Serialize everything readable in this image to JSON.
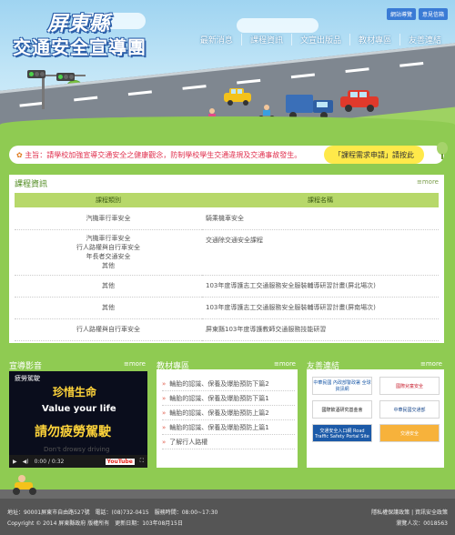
{
  "header": {
    "logo_line1": "屏東縣",
    "logo_line2": "交通安全宣導團",
    "top_links": [
      "網站導覽",
      "意見信箱"
    ],
    "nav": [
      "最新消息",
      "課程資訊",
      "文宣出版品",
      "教材專區",
      "友善連結"
    ]
  },
  "notice": {
    "label": "主旨：",
    "text": "請學校加強宣導交通安全之健康觀念，防制學校學生交通違規及交通事故發生。",
    "apply_label": "「課程需求申請」請按此"
  },
  "courses": {
    "title": "課程資訊",
    "more": "more",
    "columns": [
      "課程類別",
      "課程名稱"
    ],
    "rows": [
      {
        "category": "汽機車行車安全",
        "name": "騎乘機車安全"
      },
      {
        "category": "汽機車行車安全\n行人路權與自行車安全\n年長者交通安全\n其他",
        "name": "交通除交通安全課程"
      },
      {
        "category": "其他",
        "name": "103年度導護志工交通服務安全服裝輔導研習計畫(屏北場次)"
      },
      {
        "category": "其他",
        "name": "103年度導護志工交通服務安全服裝輔導研習計畫(屏南場次)"
      },
      {
        "category": "行人路權與自行車安全",
        "name": "屏東縣103年度導護教師交通服務技能研習"
      }
    ]
  },
  "video": {
    "title": "宣導影音",
    "more": "more",
    "player_title": "疲勞駕駛",
    "line1": "珍惜生命",
    "line2": "Value your life",
    "line3": "請勿疲勞駕駛",
    "line4": "Don't drowsy driving",
    "time": "0:00 / 0:32",
    "yt": "YouTube"
  },
  "materials": {
    "title": "教材專區",
    "more": "more",
    "items": [
      "輪胎的認識、保養及爆胎預防下篇2",
      "輪胎的認識、保養及爆胎預防下篇1",
      "輪胎的認識、保養及爆胎預防上篇2",
      "輪胎的認識、保養及爆胎預防上篇1",
      "了解行人路權"
    ]
  },
  "links": {
    "title": "友善連結",
    "more": "more",
    "logos": [
      {
        "text": "中華民國 內政部警政署 全球資訊網",
        "color": "#1c5aa8"
      },
      {
        "text": "國際兒童安全",
        "color": "#c8202f"
      },
      {
        "text": "國際飲酒研究基金會",
        "color": "#222222"
      },
      {
        "text": "中華民國交通部",
        "color": "#1c4b8f"
      },
      {
        "text": "交通安全入口網 Road Traffic Safety Portal Site",
        "color": "#1c5aa8"
      },
      {
        "text": "交通安全",
        "color": "#e07a1c"
      }
    ]
  },
  "footer": {
    "address": "地址：90001屏東市自由路527號　電話：(08)732-0415　服務時間：08:00~17:30",
    "copyright": "Copyright © 2014 屏東縣政府 版權所有　更新日期：103年08月15日",
    "right1": "隱私權保護政策 | 資訊安全政策",
    "right2": "瀏覽人次：0018563"
  }
}
